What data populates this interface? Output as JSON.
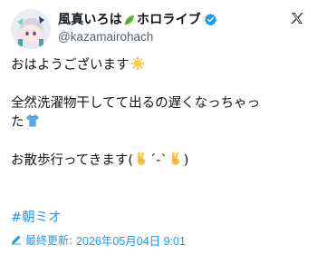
{
  "post": {
    "author": {
      "display_name_1": "風真いろは",
      "display_name_2": "ホロライブ",
      "handle": "@kazamairohach",
      "name_icon": "leaf-icon",
      "badge_icon": "verified-icon"
    },
    "platform_icon": "x-logo-icon",
    "text": {
      "line1": "おはようございます",
      "line2a": "全然洗濯物干してて出るの遅くなっちゃっ",
      "line2b": "た",
      "line3a": "お散歩行ってきます(",
      "line3b": "´-`",
      "line3c": ")"
    },
    "emojis": [
      "sun-emoji",
      "tshirt-emoji",
      "victory-hand-emoji",
      "victory-hand-emoji"
    ],
    "hashtag": "#朝ミオ",
    "footer": {
      "label": "最終更新:",
      "date": "2026年05月04日 9:01",
      "icon": "pencil-icon"
    }
  },
  "colors": {
    "link": "#1d9bf0",
    "text": "#0f1419",
    "secondary": "#536471",
    "background": "#ffffff"
  }
}
